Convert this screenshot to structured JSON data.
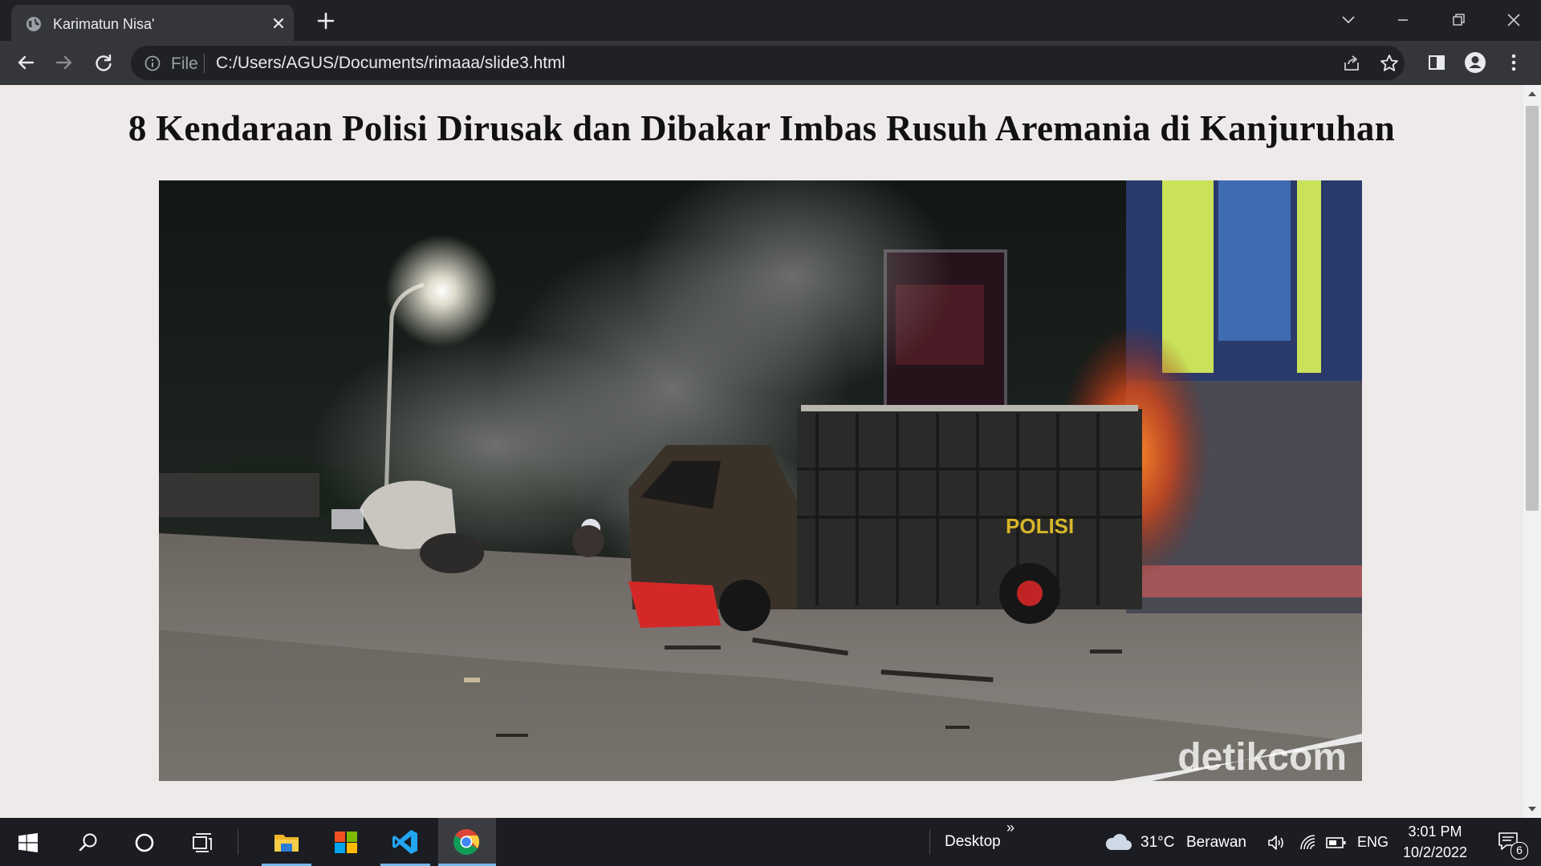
{
  "browser": {
    "tab_title": "Karimatun Nisa'",
    "file_label": "File",
    "url": "C:/Users/AGUS/Documents/rimaaa/slide3.html",
    "icons": {
      "favicon": "globe-icon",
      "tab_close": "close-icon",
      "new_tab": "plus-icon",
      "tab_search": "chevron-down-icon",
      "minimize": "minimize-icon",
      "restore": "restore-icon",
      "close_window": "close-icon",
      "back": "arrow-left-icon",
      "forward": "arrow-right-icon",
      "reload": "reload-icon",
      "site_info": "info-icon",
      "share": "share-icon",
      "bookmark": "star-icon",
      "side_panel": "side-panel-icon",
      "profile": "profile-icon",
      "menu": "kebab-menu-icon"
    },
    "colors": {
      "frame": "#202124",
      "toolbar": "#35363a",
      "text": "#e8eaed"
    }
  },
  "page": {
    "heading": "8 Kendaraan Polisi Dirusak dan Dibakar Imbas Rusuh Aremania di Kanjuruhan",
    "photo": {
      "subject": "burnt police truck on a smoky street at night",
      "truck_text": "POLISI",
      "watermark": "detikcom"
    },
    "background": "#efeaea"
  },
  "taskbar": {
    "icons": [
      "windows-start-icon",
      "search-icon",
      "cortana-icon",
      "task-view-icon",
      "file-explorer-icon",
      "microsoft-store-icon",
      "vscode-icon",
      "chrome-icon"
    ],
    "desktop_label": "Desktop",
    "overflow_label": "»",
    "weather": {
      "temp": "31°C",
      "condition": "Berawan",
      "icon": "cloud-icon"
    },
    "language": "ENG",
    "time": "3:01 PM",
    "date": "10/2/2022",
    "notification_count": "6"
  }
}
